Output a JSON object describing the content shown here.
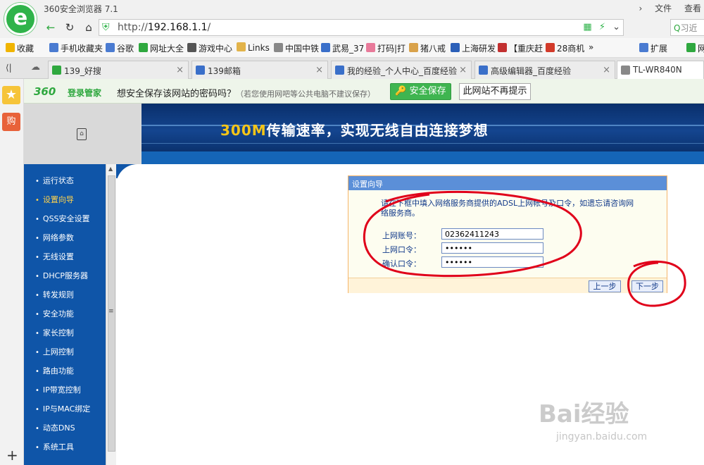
{
  "window": {
    "title": "360安全浏览器 7.1",
    "menu_file": "文件",
    "menu_view": "查看"
  },
  "navbar": {
    "url_prefix": "http://",
    "url_host": "192.168.1.1",
    "url_suffix": "/",
    "search_placeholder": "习近"
  },
  "bookmarks": [
    {
      "label": "收藏",
      "icon": "star-icon",
      "color": "#f0b400"
    },
    {
      "label": "手机收藏夹",
      "icon": "phone-icon",
      "color": "#4a7bd1"
    },
    {
      "label": "谷歌",
      "icon": "google-icon",
      "color": "#4a7bd1"
    },
    {
      "label": "网址大全",
      "icon": "compass-icon",
      "color": "#2fa83f"
    },
    {
      "label": "游戏中心",
      "icon": "gamepad-icon",
      "color": "#555555"
    },
    {
      "label": "Links",
      "icon": "folder-icon",
      "color": "#e2b34a"
    },
    {
      "label": "中国中铁",
      "icon": "page-icon",
      "color": "#888888"
    },
    {
      "label": "武易_37",
      "icon": "game-icon",
      "color": "#3a6fc9"
    },
    {
      "label": "打码|打",
      "icon": "pig-icon",
      "color": "#e87a9a"
    },
    {
      "label": "猪八戒",
      "icon": "zbj-icon",
      "color": "#d9a24a"
    },
    {
      "label": "上海研发",
      "icon": "pin-icon",
      "color": "#2b5fb8"
    },
    {
      "label": "【重庆赶",
      "icon": "grid-icon",
      "color": "#c23030"
    },
    {
      "label": "28商机",
      "icon": "shop-icon",
      "color": "#d23a2a"
    },
    {
      "label": "扩展",
      "icon": "extension-icon",
      "color": "#4a7bd1"
    },
    {
      "label": "网",
      "icon": "yen-icon",
      "color": "#2fa83f"
    }
  ],
  "tabs": [
    {
      "label": "139_好搜",
      "icon": "search-icon",
      "color": "#2fa83f"
    },
    {
      "label": "139邮箱",
      "icon": "mail-icon",
      "color": "#3a6fc9"
    },
    {
      "label": "我的经验_个人中心_百度经验",
      "icon": "paw-icon",
      "color": "#3a6fc9"
    },
    {
      "label": "高级编辑器_百度经验",
      "icon": "paw-icon",
      "color": "#3a6fc9"
    },
    {
      "label": "TL-WR840N",
      "icon": "page-icon",
      "color": "#888888"
    }
  ],
  "password_bar": {
    "brand": "360",
    "brand_sub": "登录管家",
    "question": "想安全保存该网站的密码吗？",
    "hint": "（若您使用网吧等公共电脑不建议保存）",
    "save_label": "安全保存",
    "never_label": "此网站不再提示"
  },
  "router": {
    "banner_highlight": "300M",
    "banner_text": "传输速率，实现无线自由连接梦想",
    "menu": [
      "运行状态",
      "设置向导",
      "QSS安全设置",
      "网络参数",
      "无线设置",
      "DHCP服务器",
      "转发规则",
      "安全功能",
      "家长控制",
      "上网控制",
      "路由功能",
      "IP带宽控制",
      "IP与MAC绑定",
      "动态DNS",
      "系统工具"
    ],
    "selected_menu": 1
  },
  "wizard": {
    "title": "设置向导",
    "description": "请在下框中填入网络服务商提供的ADSL上网帐号及口令，如遗忘请咨询网络服务商。",
    "account_label": "上网账号：",
    "account_value": "02362411243",
    "password_label": "上网口令：",
    "password_value": "••••••",
    "confirm_label": "确认口令：",
    "confirm_value": "••••••",
    "prev_label": "上一步",
    "next_label": "下一步"
  },
  "watermark": {
    "main": "Bai经验",
    "sub": "jingyan.baidu.com"
  },
  "colors": {
    "annotation": "#e0001a",
    "menu_bg": "#0f55a8",
    "accent": "#2fb34a"
  }
}
